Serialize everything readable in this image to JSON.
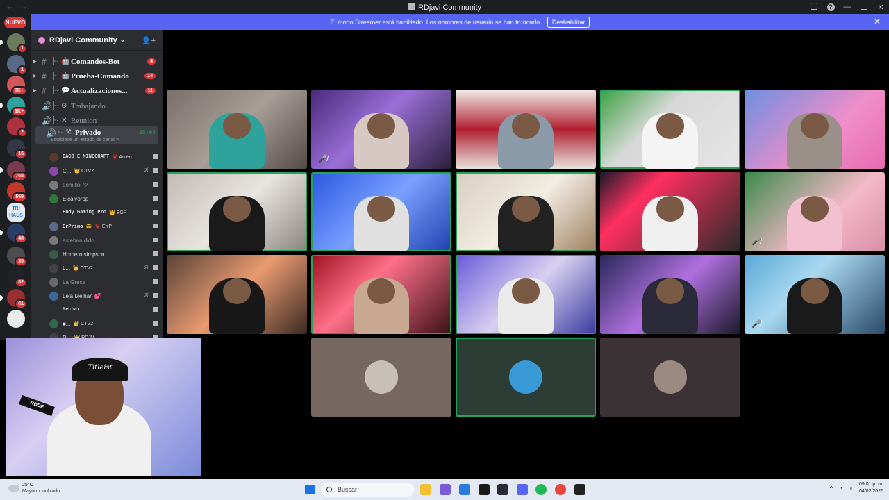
{
  "window": {
    "title": "RDjavi Community",
    "back_icon": "←",
    "forward_icon": "→"
  },
  "banner": {
    "text": "El modo Streamer está habilitado. Los nombres de usuario se han truncado.",
    "button": "Deshabilitar",
    "close": "✕"
  },
  "rail": {
    "new_label": "NUEVO",
    "servers": [
      {
        "color": "#6b7a5a",
        "badge": "1"
      },
      {
        "color": "#5a6b8a",
        "badge": "1"
      },
      {
        "color": "#d2565a",
        "badge": "8K+"
      },
      {
        "color": "#2ea39b",
        "badge": "1K+"
      },
      {
        "color": "#b03040",
        "badge": "2"
      },
      {
        "color": "#333944",
        "badge": "16"
      },
      {
        "color": "#7b3b4e",
        "badge": "768"
      },
      {
        "color": "#c0392b",
        "badge": "559"
      },
      {
        "color": "#e6e9f0",
        "badge": ""
      },
      {
        "color": "#2b3f66",
        "badge": "48"
      },
      {
        "color": "#4d4d4d",
        "badge": "30"
      },
      {
        "color": "#202226",
        "badge": "82"
      },
      {
        "color": "#9a2f2f",
        "badge": "61"
      },
      {
        "color": "#eaeaea",
        "badge": ""
      }
    ],
    "tri_haus": "TRI HAUS"
  },
  "sidebar": {
    "server_name": "RDjavi Community",
    "chevron": "⌄",
    "add_user_icon": "👤+",
    "channels": [
      {
        "type": "text",
        "name": "Comandos-Bot",
        "icon": "🤖",
        "count": "4"
      },
      {
        "type": "text",
        "name": "Prueba-Comando",
        "icon": "🤖",
        "count": "14"
      },
      {
        "type": "text",
        "name": "Actualizaciones...",
        "icon": "💬",
        "count": "11"
      },
      {
        "type": "voice",
        "name": "Trabajando",
        "icon": "⊙"
      },
      {
        "type": "voice",
        "name": "Reunion",
        "icon": "✕"
      },
      {
        "type": "voice",
        "name": "Privado",
        "icon": "⚒",
        "time": "25:08",
        "sub": "Establece un estado de canal ✎"
      }
    ],
    "users": [
      {
        "name": "CACO E MINECRAFT",
        "tag": "🦞 Amén",
        "color": "#5b3a29",
        "mono": true
      },
      {
        "name": "C...",
        "tag": "👑 CTV2",
        "color": "#8e44ad",
        "mute": "⊘̸"
      },
      {
        "name": "domillol ツ",
        "color": "#7a7a7a",
        "dim": true
      },
      {
        "name": "Elcalvorpp",
        "color": "#2d7a3e"
      },
      {
        "name": "Endy Gaming Pro",
        "tag": "👑 EGP",
        "color": "#2b2d31",
        "mono": true
      },
      {
        "name": "ErPrimo 😎",
        "tag": "🦞 ErrP",
        "color": "#5a6b8a",
        "mono": true
      },
      {
        "name": "esteban dido",
        "color": "#7a7a7a",
        "dim": true
      },
      {
        "name": "Homero simpson",
        "color": "#3a5a4a"
      },
      {
        "name": "L...",
        "tag": "👑 CTV2",
        "color": "#444",
        "mute": "⊘̸"
      },
      {
        "name": "La Greca",
        "color": "#6a6a6a",
        "dim": true
      },
      {
        "name": "Lela Meihan 💕",
        "color": "#3a6a9a",
        "mute": "⊘̸"
      },
      {
        "name": "Mechax",
        "color": "#2b2d31",
        "mono": true
      },
      {
        "name": "■...",
        "tag": "👑 CTV2",
        "color": "#2d6a4a"
      },
      {
        "name": "R...",
        "tag": "👑 RDJV",
        "color": "#444"
      }
    ]
  },
  "video_grid": {
    "tiles": [
      {
        "id": "v1",
        "bg": "linear-gradient(135deg,#7a6f6a,#a79e98 50%,#554c48)",
        "shirt": "#2ea39b",
        "speaking": false
      },
      {
        "id": "v2",
        "bg": "linear-gradient(135deg,#4a2a7a,#9b6fd8 45%,#2b1f3a)",
        "shirt": "#d6c9c4",
        "speaking": false,
        "muted": true
      },
      {
        "id": "v3",
        "bg": "linear-gradient(180deg,#f0ece8,#b02030 50%,#e8e2dc)",
        "shirt": "#8a9aa8",
        "speaking": false
      },
      {
        "id": "v4",
        "bg": "linear-gradient(135deg,#3aa040,#d8d8d8 40%,#e6e6e6)",
        "shirt": "#f4f4f4",
        "speaking": true
      },
      {
        "id": "v5",
        "bg": "linear-gradient(135deg,#6d8fe0,#f08ec8 60%,#e56bb0)",
        "shirt": "#9a8f88",
        "speaking": false
      },
      {
        "id": "v6",
        "bg": "linear-gradient(135deg,#c0bab4,#e8e4e0 50%,#8a847e)",
        "shirt": "#1a1a1a",
        "speaking": true
      },
      {
        "id": "v7",
        "bg": "linear-gradient(135deg,#2a58e0,#7aa0ff 50%,#2040b0)",
        "shirt": "#e0e0e0",
        "speaking": true
      },
      {
        "id": "v8",
        "bg": "linear-gradient(135deg,#d8cfc0,#f2ece2 50%,#a08060)",
        "shirt": "#222",
        "speaking": true
      },
      {
        "id": "v9",
        "bg": "linear-gradient(135deg,#1a1a2a,#ff3060 30%,#2a2a2a)",
        "shirt": "#f0f0f0",
        "speaking": false
      },
      {
        "id": "v10",
        "bg": "linear-gradient(135deg,#3a8a4a,#f4b8c8 60%,#d88fa8)",
        "shirt": "#f2c0d0",
        "speaking": false,
        "muted": true
      },
      {
        "id": "v11",
        "bg": "linear-gradient(135deg,#5a4438,#e89a70 50%,#3a2a22)",
        "shirt": "#181818",
        "speaking": false
      },
      {
        "id": "v12",
        "bg": "linear-gradient(135deg,#a01020,#ff7088 40%,#3a1018)",
        "shirt": "#c8a890",
        "speaking": true
      },
      {
        "id": "v13",
        "bg": "linear-gradient(135deg,#6a5ad8,#d8d0f0 50%,#3a3aa0)",
        "shirt": "#eaeaea",
        "speaking": true
      },
      {
        "id": "v14",
        "bg": "linear-gradient(135deg,#2a2a5a,#b070e0 50%,#1a1a2a)",
        "shirt": "#2a2a3a",
        "speaking": false
      },
      {
        "id": "v15",
        "bg": "linear-gradient(135deg,#5aa8d8,#a8d8f0 40%,#2a4a6a)",
        "shirt": "#1a1a1a",
        "speaking": false,
        "muted": true
      }
    ],
    "avatar_tiles": [
      {
        "id": "a1",
        "bg": "#766761",
        "avatar": "#c8c0b8",
        "speaking": false
      },
      {
        "id": "a2",
        "bg": "#2b3d34",
        "avatar": "#3a9ad8",
        "speaking": true
      },
      {
        "id": "a3",
        "bg": "#3a3234",
        "avatar": "#9a8a80",
        "speaking": false
      }
    ],
    "mute_icon": "🎤̸"
  },
  "webcam": {
    "cap_text": "Titleist",
    "mic_label": "RØDE"
  },
  "taskbar": {
    "weather_temp": "25°C",
    "weather_desc": "Mayorm. nublado",
    "search_placeholder": "Buscar",
    "apps": [
      {
        "name": "file-explorer",
        "color": "#f2c030"
      },
      {
        "name": "copilot",
        "color": "#7a5ad8"
      },
      {
        "name": "store",
        "color": "#2a7ae0"
      },
      {
        "name": "terminal",
        "color": "#1a1a1a"
      },
      {
        "name": "obs",
        "color": "#2a2a3a"
      },
      {
        "name": "discord",
        "color": "#5865f2"
      },
      {
        "name": "spotify",
        "color": "#1db954"
      },
      {
        "name": "chrome",
        "color": "#e8453c"
      },
      {
        "name": "obs-studio",
        "color": "#222"
      }
    ],
    "time": "09:01 p. m.",
    "date": "04/02/2026"
  }
}
